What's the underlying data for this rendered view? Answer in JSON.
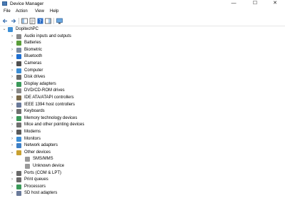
{
  "window": {
    "title": "Device Manager",
    "minimize": "—",
    "maximize": "☐",
    "close": "✕"
  },
  "menu": [
    "File",
    "Action",
    "View",
    "Help"
  ],
  "tree": {
    "root": "DopitechPC",
    "items": [
      {
        "label": "Audio inputs and outputs",
        "icon": "speaker-icon",
        "color": "#8a8a8a"
      },
      {
        "label": "Batteries",
        "icon": "battery-icon",
        "color": "#5a9e3a"
      },
      {
        "label": "Biometric",
        "icon": "fingerprint-icon",
        "color": "#7a8aa0"
      },
      {
        "label": "Bluetooth",
        "icon": "bluetooth-icon",
        "color": "#1f6fd1"
      },
      {
        "label": "Cameras",
        "icon": "camera-icon",
        "color": "#505050"
      },
      {
        "label": "Computer",
        "icon": "computer-icon",
        "color": "#3d8fd6"
      },
      {
        "label": "Disk drives",
        "icon": "disk-drive-icon",
        "color": "#6b6b6b"
      },
      {
        "label": "Display adapters",
        "icon": "display-adapter-icon",
        "color": "#3b9a5a"
      },
      {
        "label": "DVD/CD-ROM drives",
        "icon": "dvd-drive-icon",
        "color": "#8a8a8a"
      },
      {
        "label": "IDE ATA/ATAPI controllers",
        "icon": "ide-controller-icon",
        "color": "#7a6a4a"
      },
      {
        "label": "IEEE 1394 host controllers",
        "icon": "ieee1394-icon",
        "color": "#6a7a9a"
      },
      {
        "label": "Keyboards",
        "icon": "keyboard-icon",
        "color": "#707070"
      },
      {
        "label": "Memory technology devices",
        "icon": "memory-icon",
        "color": "#3b9a5a"
      },
      {
        "label": "Mice and other pointing devices",
        "icon": "mouse-icon",
        "color": "#707070"
      },
      {
        "label": "Modems",
        "icon": "modem-icon",
        "color": "#5a5a5a"
      },
      {
        "label": "Monitors",
        "icon": "monitor-icon",
        "color": "#3d8fd6"
      },
      {
        "label": "Network adapters",
        "icon": "network-adapter-icon",
        "color": "#3d7fc6"
      },
      {
        "label": "Other devices",
        "icon": "other-devices-icon",
        "color": "#c8a030",
        "expanded": true,
        "children": [
          {
            "label": "SMS/MMS",
            "icon": "unknown-device-icon",
            "color": "#9a9a9a"
          },
          {
            "label": "Unknown device",
            "icon": "unknown-device-icon",
            "color": "#9a9a9a"
          }
        ]
      },
      {
        "label": "Ports (COM & LPT)",
        "icon": "port-icon",
        "color": "#6a6a6a"
      },
      {
        "label": "Print queues",
        "icon": "printer-icon",
        "color": "#6a6a6a"
      },
      {
        "label": "Processors",
        "icon": "processor-icon",
        "color": "#3b9a5a"
      },
      {
        "label": "SD host adapters",
        "icon": "sd-adapter-icon",
        "color": "#6a7a9a"
      }
    ]
  }
}
